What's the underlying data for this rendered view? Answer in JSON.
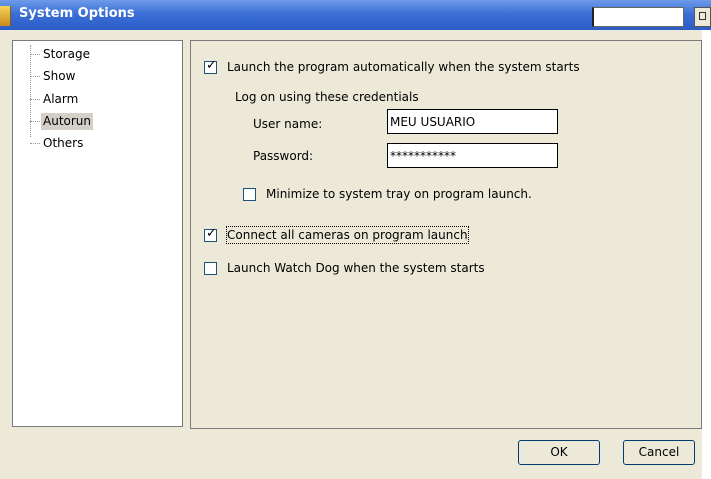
{
  "window": {
    "title": "System Options"
  },
  "tree": {
    "items": [
      {
        "label": "Storage",
        "selected": false
      },
      {
        "label": "Show",
        "selected": false
      },
      {
        "label": "Alarm",
        "selected": false
      },
      {
        "label": "Autorun",
        "selected": true
      },
      {
        "label": "Others",
        "selected": false
      }
    ]
  },
  "autorun": {
    "launch_auto": {
      "label": "Launch the program automatically when the system starts",
      "checked": true
    },
    "credentials_heading": "Log on using these credentials",
    "username": {
      "label": "User name:",
      "value": "MEU USUARIO"
    },
    "password": {
      "label": "Password:",
      "value": "***********"
    },
    "minimize_tray": {
      "label": "Minimize to system tray on program launch.",
      "checked": false
    },
    "connect_cameras": {
      "label": "Connect all cameras on program launch",
      "checked": true
    },
    "watchdog": {
      "label": "Launch Watch Dog when the system starts",
      "checked": false
    }
  },
  "buttons": {
    "ok": "OK",
    "cancel": "Cancel"
  }
}
